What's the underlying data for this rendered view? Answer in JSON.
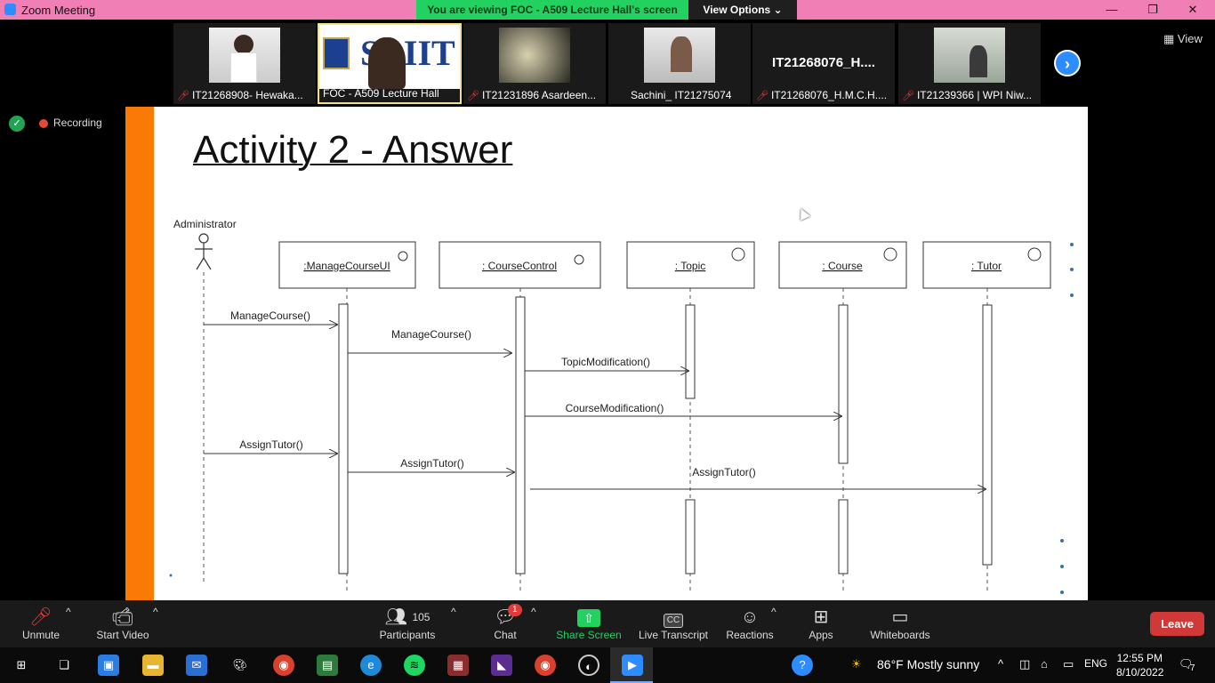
{
  "titlebar": {
    "title": "Zoom Meeting",
    "viewing_banner": "You are viewing FOC - A509 Lecture Hall's screen",
    "view_options": "View Options ⌄",
    "minimize": "—",
    "maximize": "❐",
    "close": "✕"
  },
  "participants_strip": [
    {
      "label": "IT21268908- Hewaka...",
      "muted": true
    },
    {
      "label": "FOC - A509 Lecture Hall",
      "muted": false
    },
    {
      "label": "IT21231896 Asardeen...",
      "muted": true
    },
    {
      "label": "Sachini_ IT21275074",
      "muted": false
    },
    {
      "label": "IT21268076_H.M.C.H....",
      "muted": true,
      "big_name": "IT21268076_H...."
    },
    {
      "label": "IT21239366 | WPI Niw...",
      "muted": true
    }
  ],
  "view_button": "View",
  "recording": {
    "label": "Recording"
  },
  "slide": {
    "title": "Activity 2 - Answer",
    "actor": "Administrator",
    "lifelines": [
      ":ManageCourseUI",
      ": CourseControl",
      ": Topic",
      ": Course",
      ": Tutor"
    ],
    "messages": [
      "ManageCourse()",
      "ManageCourse()",
      "TopicModification()",
      "CourseModification()",
      "AssignTutor()",
      "AssignTutor()",
      "AssignTutor()"
    ]
  },
  "toolbar": {
    "unmute": "Unmute",
    "start_video": "Start Video",
    "participants": "Participants",
    "participants_count": "105",
    "chat": "Chat",
    "chat_badge": "1",
    "share_screen": "Share Screen",
    "live_transcript": "Live Transcript",
    "cc": "CC",
    "reactions": "Reactions",
    "apps": "Apps",
    "whiteboards": "Whiteboards",
    "leave": "Leave"
  },
  "taskbar": {
    "weather": "86°F  Mostly sunny",
    "language": "ENG",
    "time": "12:55 PM",
    "date": "8/10/2022",
    "notifications": "7"
  },
  "colors": {
    "banner_green": "#23d160",
    "titlebar_pink": "#f07fb6",
    "slide_accent": "#fa7a06",
    "leave_red": "#d13838",
    "zoom_blue": "#2d8cff"
  }
}
